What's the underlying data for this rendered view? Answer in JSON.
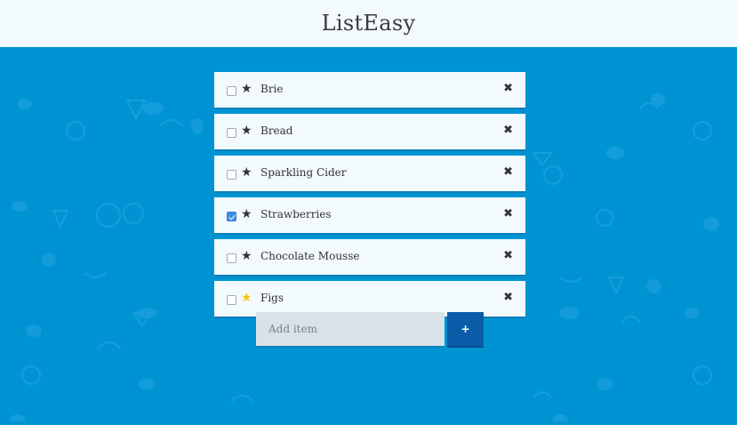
{
  "app": {
    "title": "ListEasy"
  },
  "items": [
    {
      "label": "Brie",
      "checked": false,
      "favorite": false,
      "remove_icon": "close-icon"
    },
    {
      "label": "Bread",
      "checked": false,
      "favorite": false,
      "remove_icon": "close-icon"
    },
    {
      "label": "Sparkling Cider",
      "checked": false,
      "favorite": false,
      "remove_icon": "close-icon"
    },
    {
      "label": "Strawberries",
      "checked": true,
      "favorite": false,
      "remove_icon": "close-icon"
    },
    {
      "label": "Chocolate Mousse",
      "checked": false,
      "favorite": false,
      "remove_icon": "close-icon"
    },
    {
      "label": "Figs",
      "checked": false,
      "favorite": true,
      "remove_icon": "close-icon"
    }
  ],
  "add_form": {
    "placeholder": "Add item",
    "value": "",
    "button_label": "+"
  },
  "glyphs": {
    "star": "★",
    "remove": "✖"
  },
  "colors": {
    "background": "#0093d3",
    "header": "#f2fafe",
    "accent_button": "#0a5ca8",
    "favorite_star": "#f5c518",
    "checked_box": "#3b8ee6"
  }
}
